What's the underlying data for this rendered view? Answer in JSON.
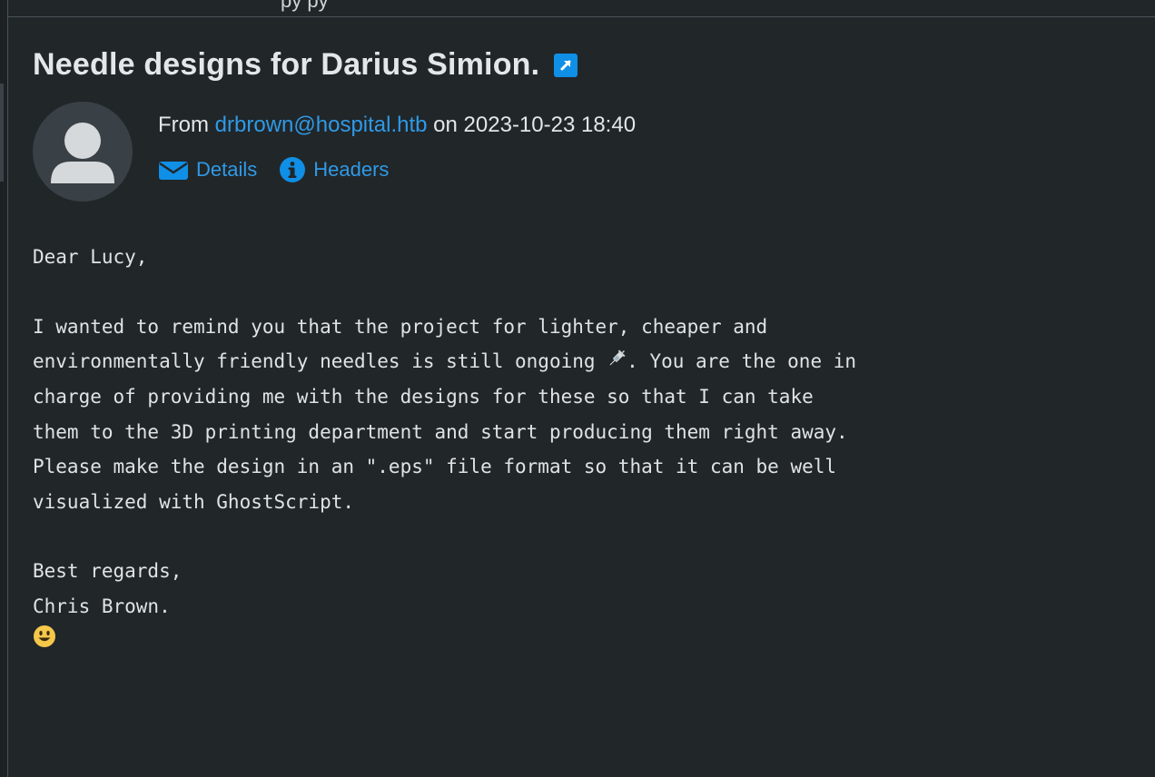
{
  "top_bar": {
    "partial_text": "                    py  py"
  },
  "message": {
    "subject": "Needle designs for Darius Simion.",
    "from_prefix": "From",
    "sender": "drbrown@hospital.htb",
    "date_prefix": "on",
    "date": "2023-10-23 18:40",
    "links": {
      "details": "Details",
      "headers": "Headers"
    },
    "body": {
      "greeting": "Dear Lucy,",
      "line1": "I wanted to remind you that the project for lighter, cheaper and",
      "line2_before": "environmentally friendly needles is still ongoing ",
      "line2_after": ". You are the one in",
      "line3": "charge of providing me with the designs for these so that I can take",
      "line4": "them to the 3D printing department and start producing them right away.",
      "line5": "Please make the design in an \".eps\" file format so that it can be well",
      "line6": "visualized with GhostScript.",
      "closing": "Best regards,",
      "signature": "Chris Brown."
    }
  },
  "icons": {
    "open": "external-open-icon",
    "avatar": "user-avatar-icon",
    "details": "envelope-icon",
    "headers": "info-icon",
    "syringe": "syringe-icon",
    "smiley": "smiley-icon"
  },
  "colors": {
    "background": "#212629",
    "link": "#2f9ae6",
    "accent_icon": "#0f8fe6",
    "smiley": "#f5c84a"
  }
}
